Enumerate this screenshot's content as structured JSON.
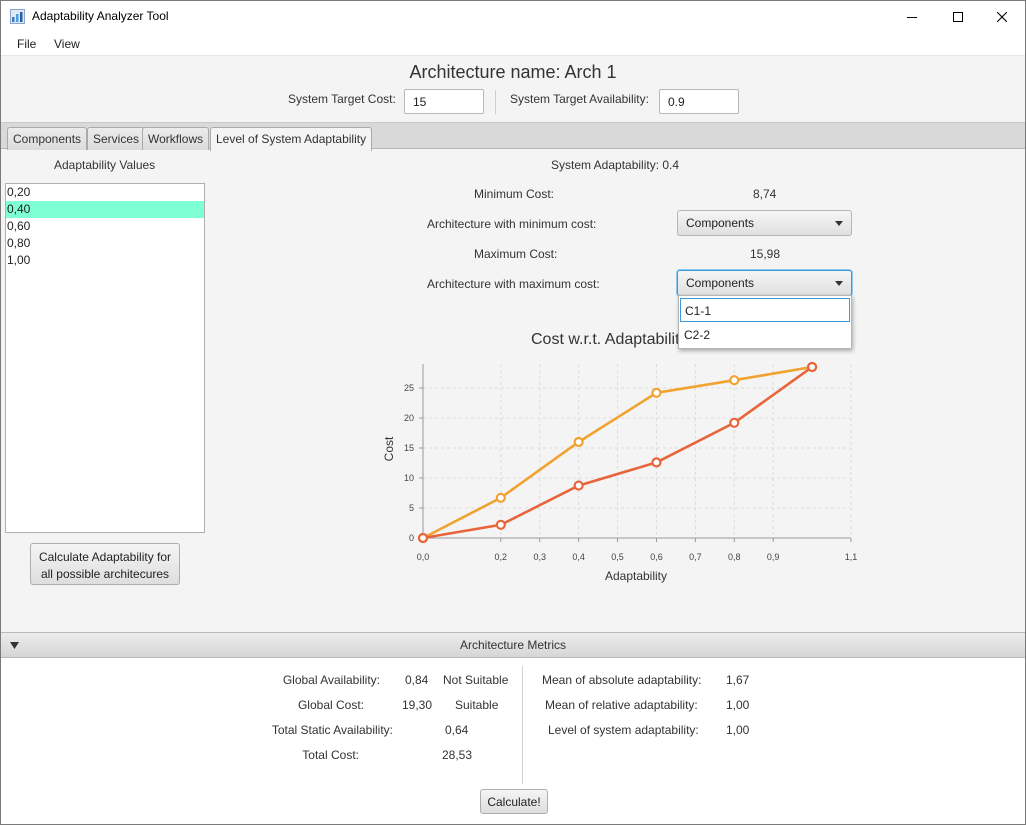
{
  "window": {
    "title": "Adaptability Analyzer Tool",
    "controls": [
      "minimize",
      "maximize",
      "close"
    ]
  },
  "menu": {
    "items": [
      "File",
      "View"
    ]
  },
  "header": {
    "architecture_label": "Architecture name: Arch 1",
    "target_cost_label": "System Target Cost:",
    "target_cost_value": "15",
    "target_availability_label": "System Target Availability:",
    "target_availability_value": "0.9"
  },
  "tabs": [
    {
      "label": "Components"
    },
    {
      "label": "Services"
    },
    {
      "label": "Workflows"
    },
    {
      "label": "Level of System Adaptability",
      "active": true
    }
  ],
  "left_panel": {
    "title": "Adaptability Values",
    "values": [
      "0,20",
      "0,40",
      "0,60",
      "0,80",
      "1,00"
    ],
    "selected_index": 1,
    "calculate_button": [
      "Calculate Adaptability for",
      "all possible architecures"
    ]
  },
  "summary": {
    "system_adaptability": "System Adaptability: 0.4",
    "min_cost_label": "Minimum Cost:",
    "min_cost_value": "8,74",
    "arch_min_label": "Architecture with minimum cost:",
    "arch_min_value": "Components",
    "max_cost_label": "Maximum Cost:",
    "max_cost_value": "15,98",
    "arch_max_label": "Architecture with maximum cost:",
    "arch_max_value": "Components",
    "dropdown_options": [
      "C1-1",
      "C2-2"
    ]
  },
  "chart_data": {
    "type": "line",
    "title": "Cost w.r.t. Adaptability",
    "xlabel": "Adaptability",
    "ylabel": "Cost",
    "xlim": [
      0.0,
      1.1
    ],
    "ylim": [
      0,
      29
    ],
    "x_ticks": [
      "0,0",
      "0,2",
      "0,3",
      "0,4",
      "0,5",
      "0,6",
      "0,7",
      "0,8",
      "0,9",
      "1,1"
    ],
    "x_tick_values": [
      0.0,
      0.2,
      0.3,
      0.4,
      0.5,
      0.6,
      0.7,
      0.8,
      0.9,
      1.1
    ],
    "y_ticks": [
      0,
      5,
      10,
      15,
      20,
      25
    ],
    "grid": true,
    "series": [
      {
        "color": "#f0a330",
        "points": [
          [
            0.0,
            0.0
          ],
          [
            0.2,
            6.7
          ],
          [
            0.4,
            16.0
          ],
          [
            0.6,
            24.2
          ],
          [
            0.8,
            26.3
          ],
          [
            1.0,
            28.5
          ]
        ]
      },
      {
        "color": "#e8643a",
        "points": [
          [
            0.0,
            0.0
          ],
          [
            0.2,
            2.2
          ],
          [
            0.4,
            8.74
          ],
          [
            0.6,
            12.6
          ],
          [
            0.8,
            19.2
          ],
          [
            1.0,
            28.5
          ]
        ]
      }
    ]
  },
  "metrics": {
    "section_title": "Architecture Metrics",
    "global_availability_label": "Global Availability:",
    "global_availability_value": "0,84",
    "global_availability_status": "Not Suitable",
    "global_cost_label": "Global Cost:",
    "global_cost_value": "19,30",
    "global_cost_status": "Suitable",
    "total_static_availability_label": "Total Static Availability:",
    "total_static_availability_value": "0,64",
    "total_cost_label": "Total Cost:",
    "total_cost_value": "28,53",
    "mean_absolute_label": "Mean of absolute adaptability:",
    "mean_absolute_value": "1,67",
    "mean_relative_label": "Mean of relative adaptability:",
    "mean_relative_value": "1,00",
    "level_label": "Level of system adaptability:",
    "level_value": "1,00",
    "calculate_button": "Calculate!"
  }
}
